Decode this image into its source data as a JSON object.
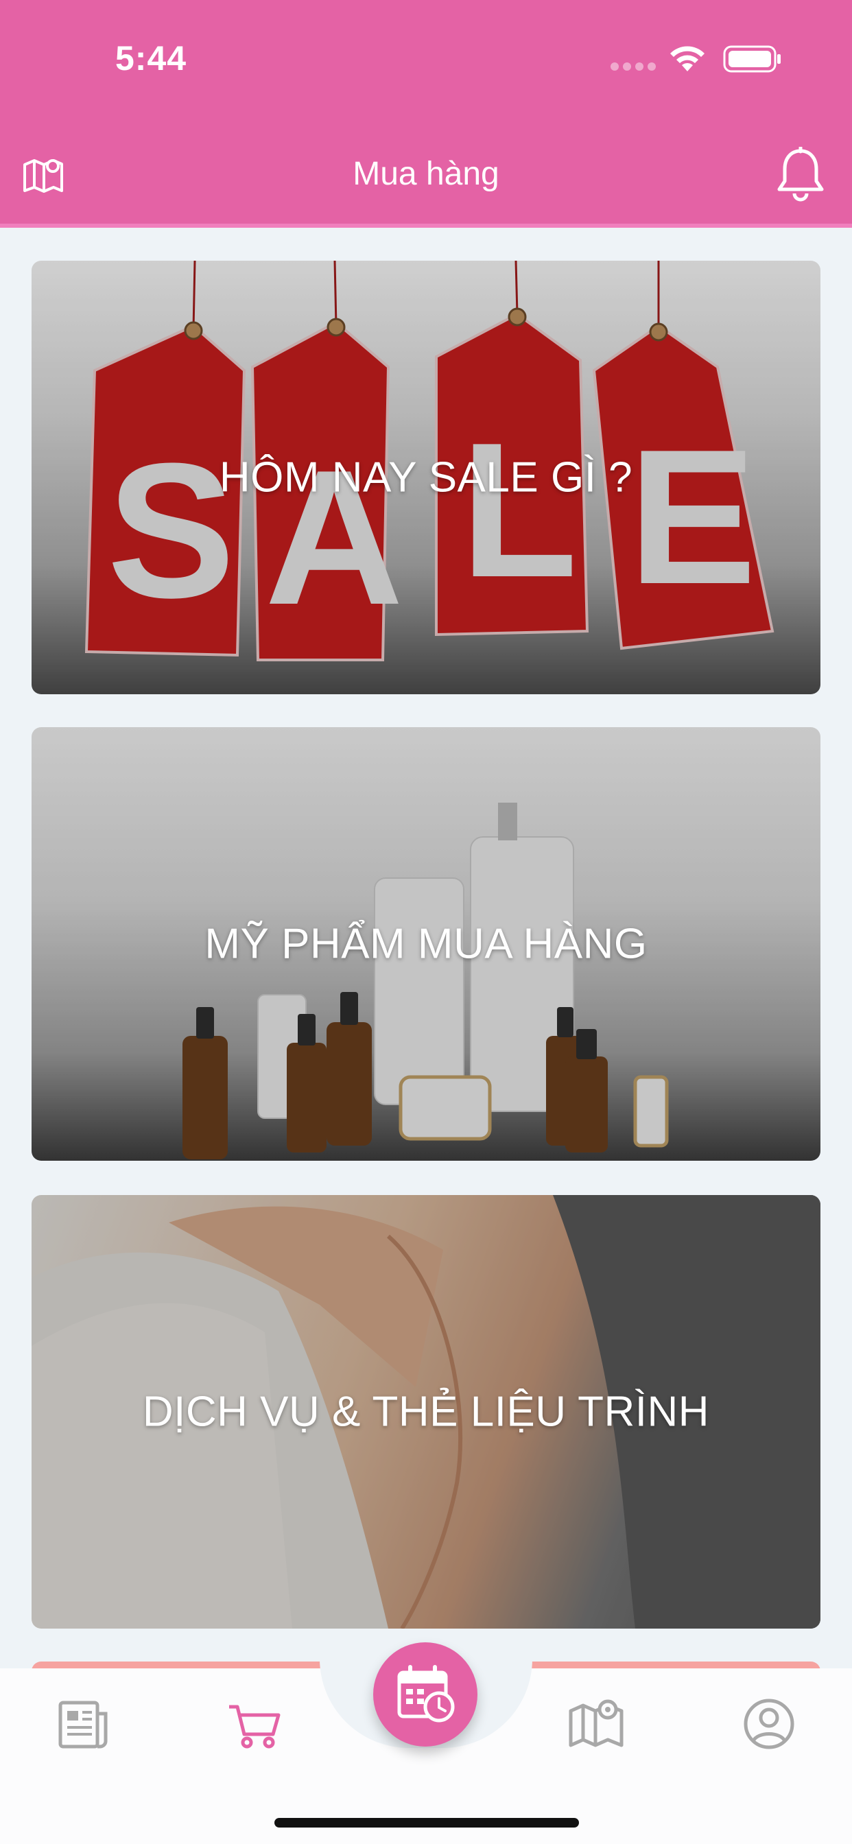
{
  "status_bar": {
    "time": "5:44"
  },
  "header": {
    "title": "Mua hàng"
  },
  "cards": [
    {
      "label": "HÔM NAY SALE GÌ ?"
    },
    {
      "label": "MỸ PHẨM MUA HÀNG"
    },
    {
      "label": "DỊCH VỤ & THẺ LIỆU TRÌNH"
    }
  ],
  "tabbar": {
    "items": [
      {
        "icon": "newspaper-icon"
      },
      {
        "icon": "cart-icon",
        "active": true
      },
      {
        "icon": "calendar-clock-icon"
      },
      {
        "icon": "map-pin-icon"
      },
      {
        "icon": "user-circle-icon"
      }
    ]
  },
  "colors": {
    "accent": "#e462a5",
    "tab_inactive": "#a8a8a8",
    "background": "#eef3f7"
  }
}
